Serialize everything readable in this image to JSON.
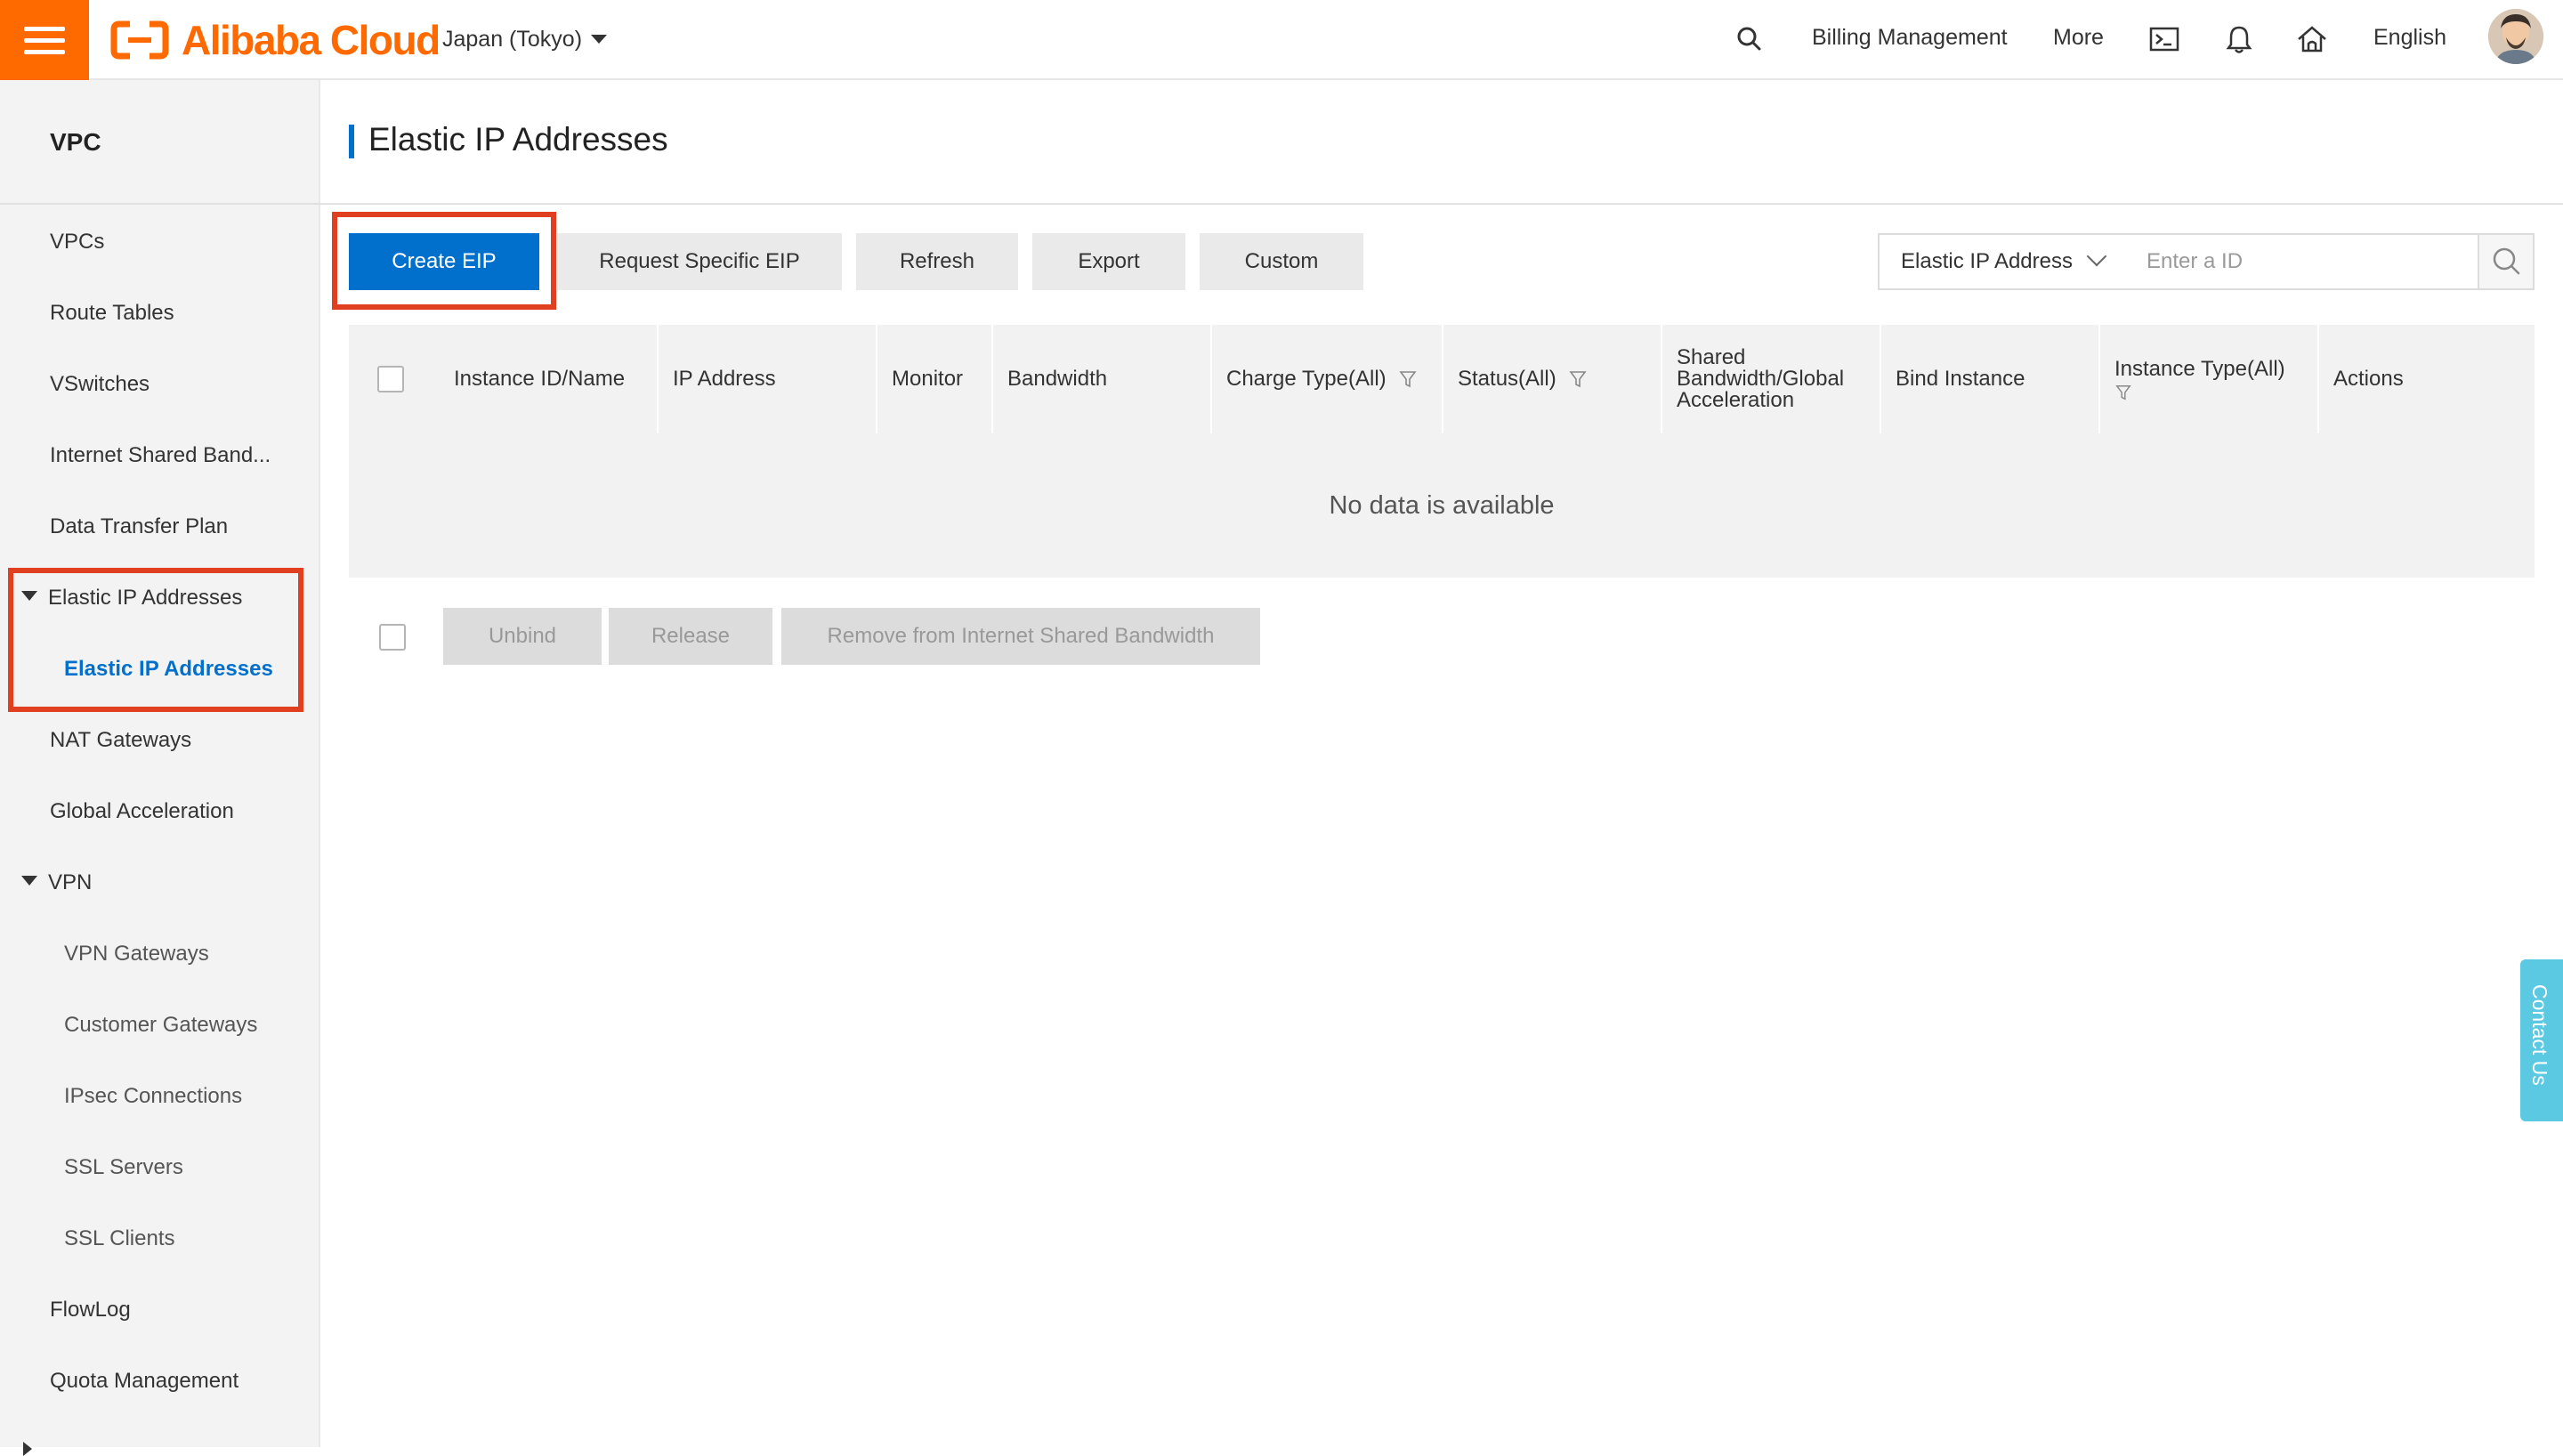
{
  "header": {
    "brand": "Alibaba Cloud",
    "region": "Japan (Tokyo)",
    "links": {
      "billing": "Billing Management",
      "more": "More",
      "language": "English"
    },
    "icons": [
      "menu-icon",
      "search-icon",
      "terminal-icon",
      "bell-icon",
      "home-icon"
    ]
  },
  "sidebar": {
    "title": "VPC",
    "items": [
      "VPCs",
      "Route Tables",
      "VSwitches",
      "Internet Shared Band...",
      "Data Transfer Plan",
      "Elastic IP Addresses",
      "Elastic IP Addresses",
      "NAT Gateways",
      "Global Acceleration",
      "VPN",
      "VPN Gateways",
      "Customer Gateways",
      "IPsec Connections",
      "SSL Servers",
      "SSL Clients",
      "FlowLog",
      "Quota Management"
    ],
    "active_index": 6
  },
  "main": {
    "title": "Elastic IP Addresses",
    "toolbar": {
      "create": "Create EIP",
      "request": "Request Specific EIP",
      "refresh": "Refresh",
      "export": "Export",
      "custom": "Custom"
    },
    "search": {
      "field": "Elastic IP Address",
      "placeholder": "Enter a ID"
    },
    "table": {
      "columns": [
        "Instance ID/Name",
        "IP Address",
        "Monitor",
        "Bandwidth",
        "Charge Type(All)",
        "Status(All)",
        "Shared Bandwidth/Global Acceleration",
        "Bind Instance",
        "Instance Type(All)",
        "Actions"
      ],
      "shared_col_lines": [
        "Shared",
        "Bandwidth/Global",
        "Acceleration"
      ],
      "empty": "No data is available"
    },
    "bulk_actions": {
      "unbind": "Unbind",
      "release": "Release",
      "remove": "Remove from Internet Shared Bandwidth"
    }
  },
  "contact": "Contact Us",
  "colors": {
    "brand": "#ff6a00",
    "primary": "#0070cc",
    "highlight": "#e0401f",
    "contact": "#5bc9e2"
  }
}
